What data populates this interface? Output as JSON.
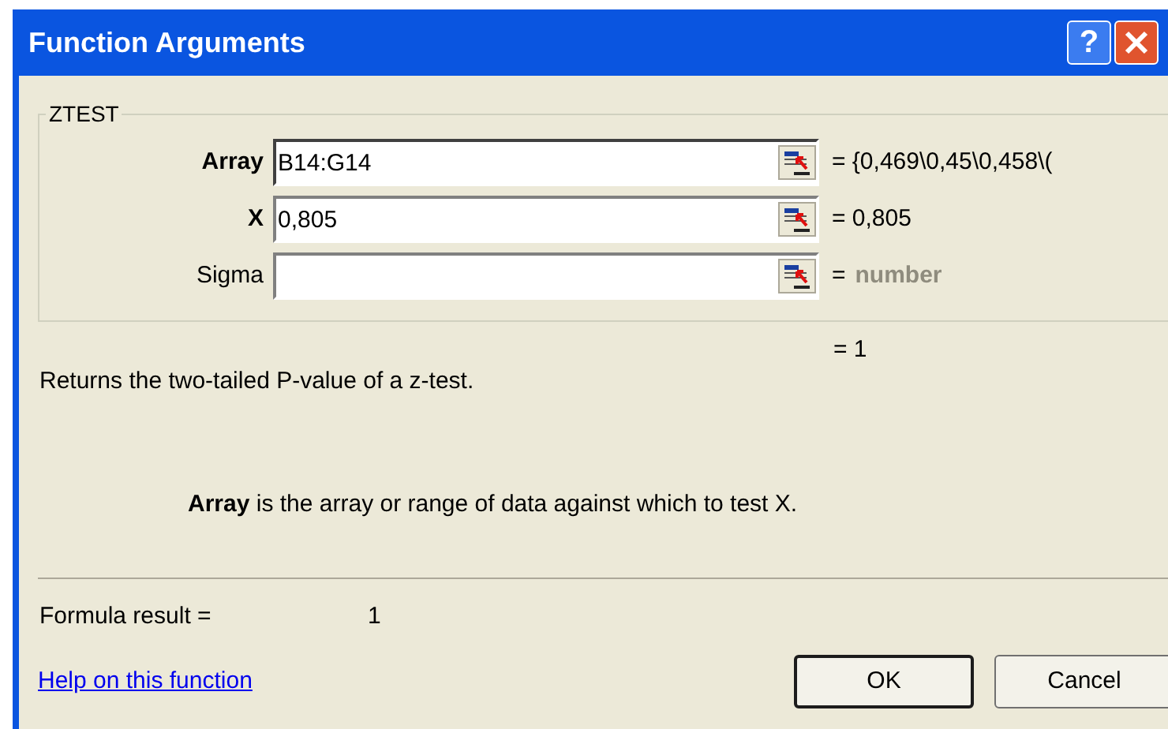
{
  "window": {
    "title": "Function Arguments",
    "buttons": [
      {
        "kind": "help",
        "label": "?"
      },
      {
        "kind": "close"
      }
    ]
  },
  "function": {
    "name": "ZTEST",
    "arguments": [
      {
        "label": "Array",
        "required": true,
        "value": "B14:G14",
        "focused": true,
        "result": "= {0,469\\0,45\\0,458\\(",
        "kind": "value"
      },
      {
        "label": "X",
        "required": true,
        "value": "0,805",
        "focused": false,
        "result": "= 0,805",
        "kind": "value"
      },
      {
        "label": "Sigma",
        "required": false,
        "focused": false,
        "result_sign": "=",
        "result": "number",
        "kind": "hint"
      }
    ],
    "result": "= 1",
    "description": "Returns the two-tailed P-value of a z-test.",
    "argument_help": "**Array** is the array or range of data against which to test X."
  },
  "formula_result": {
    "label": "Formula result =",
    "value": "1"
  },
  "help_link": "Help on this function",
  "buttons": [
    {
      "label": "OK",
      "default": true
    },
    {
      "label": "Cancel",
      "default": false
    }
  ]
}
